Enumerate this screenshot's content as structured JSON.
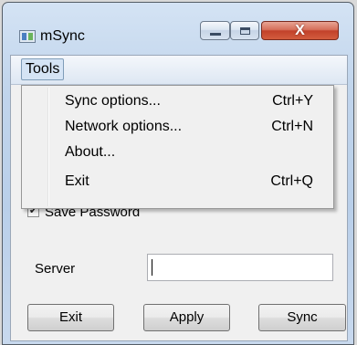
{
  "window": {
    "title": "mSync",
    "controls": {
      "minimize": "",
      "maximize": "",
      "close": "X"
    }
  },
  "menubar": {
    "tools_label": "Tools"
  },
  "tools_menu": {
    "items": [
      {
        "label": "Sync options...",
        "shortcut": "Ctrl+Y"
      },
      {
        "label": "Network options...",
        "shortcut": "Ctrl+N"
      },
      {
        "label": "About...",
        "shortcut": ""
      },
      {
        "label": "Exit",
        "shortcut": "Ctrl+Q"
      }
    ]
  },
  "form": {
    "save_password_label": "Save Password",
    "save_password_checked": true,
    "checkmark": "✔",
    "server_label": "Server",
    "server_value": ""
  },
  "buttons": {
    "exit": "Exit",
    "apply": "Apply",
    "sync": "Sync"
  },
  "colors": {
    "close_button": "#c2412b",
    "title_gradient": "#c1d5ec"
  }
}
